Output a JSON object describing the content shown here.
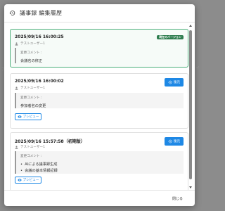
{
  "backdrop": {
    "left_text": "ア",
    "right_text": "イ"
  },
  "dialog": {
    "title": "議事録 編集履歴",
    "close_label": "閉じる"
  },
  "labels": {
    "comment_label": "変更コメント :",
    "restore_label": "復元",
    "preview_label": "プレビュー"
  },
  "versions": [
    {
      "date": "2025/09/16 16:00:25",
      "user": "テストユーザー1",
      "badge": "現在のバージョン",
      "comment": "会議名の修正"
    },
    {
      "date": "2025/09/16 16:00:02",
      "user": "テストユーザー1",
      "comment": "参加者名の変更"
    },
    {
      "date": "2025/09/16 15:57:58（初期版）",
      "user": "テストユーザー1",
      "comment_items": [
        "AIによる議事録生成",
        "会議の基本情報記録"
      ]
    }
  ],
  "colors": {
    "primary": "#1e88e5",
    "current_badge": "#2e7d4f",
    "current_border": "#4caf7a"
  },
  "icons": {
    "header": "history-icon",
    "user": "person-icon",
    "restore": "restore-icon",
    "preview": "eye-icon"
  }
}
